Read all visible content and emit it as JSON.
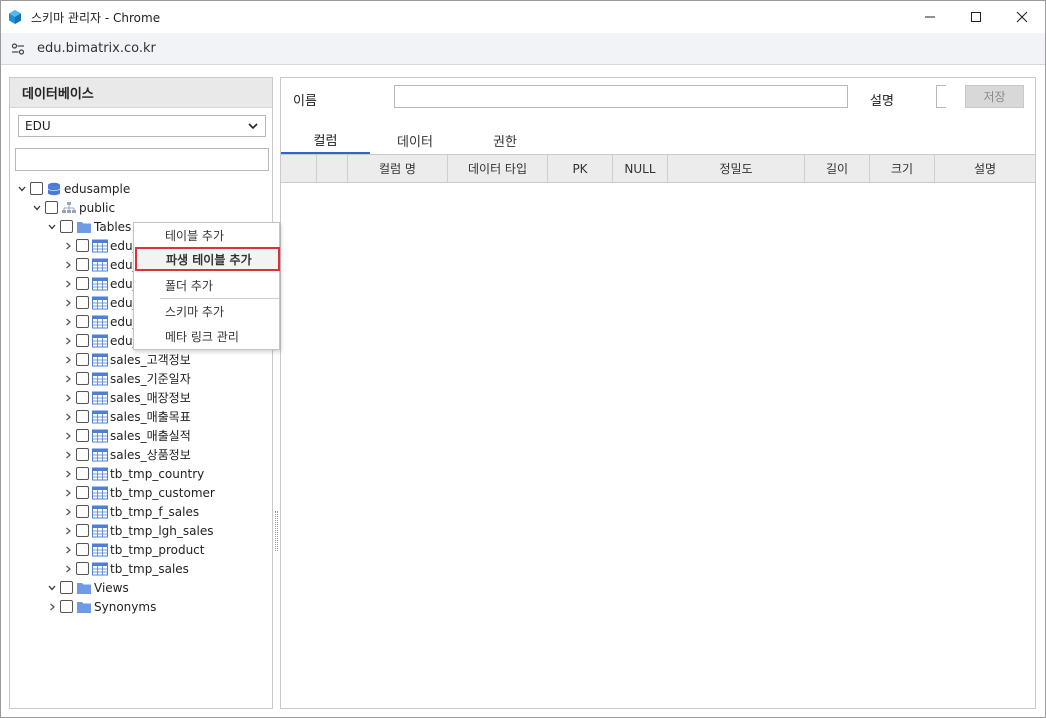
{
  "window": {
    "title": "스키마 관리자 - Chrome"
  },
  "browser": {
    "url": "edu.bimatrix.co.kr"
  },
  "left": {
    "header": "데이터베이스",
    "db_select": "EDU",
    "search_value": "",
    "tree": [
      {
        "label": "edusample",
        "icon": "database-icon",
        "expanded": true,
        "level": 0
      },
      {
        "label": "public",
        "icon": "schema-icon",
        "expanded": true,
        "level": 1
      },
      {
        "label": "Tables",
        "icon": "folder-icon",
        "expanded": true,
        "level": 2
      },
      {
        "label": "edu_",
        "icon": "table-icon",
        "level": 3
      },
      {
        "label": "edu_",
        "icon": "table-icon",
        "level": 3
      },
      {
        "label": "edu_",
        "icon": "table-icon",
        "level": 3
      },
      {
        "label": "edu_",
        "icon": "table-icon",
        "level": 3
      },
      {
        "label": "edu_",
        "icon": "table-icon",
        "level": 3
      },
      {
        "label": "edu_",
        "icon": "table-icon",
        "level": 3
      },
      {
        "label": "sales_고객정보",
        "icon": "table-icon",
        "level": 3
      },
      {
        "label": "sales_기준일자",
        "icon": "table-icon",
        "level": 3
      },
      {
        "label": "sales_매장정보",
        "icon": "table-icon",
        "level": 3
      },
      {
        "label": "sales_매출목표",
        "icon": "table-icon",
        "level": 3
      },
      {
        "label": "sales_매출실적",
        "icon": "table-icon",
        "level": 3
      },
      {
        "label": "sales_상품정보",
        "icon": "table-icon",
        "level": 3
      },
      {
        "label": "tb_tmp_country",
        "icon": "table-icon",
        "level": 3
      },
      {
        "label": "tb_tmp_customer",
        "icon": "table-icon",
        "level": 3
      },
      {
        "label": "tb_tmp_f_sales",
        "icon": "table-icon",
        "level": 3
      },
      {
        "label": "tb_tmp_lgh_sales",
        "icon": "table-icon",
        "level": 3
      },
      {
        "label": "tb_tmp_product",
        "icon": "table-icon",
        "level": 3
      },
      {
        "label": "tb_tmp_sales",
        "icon": "table-icon",
        "level": 3
      },
      {
        "label": "Views",
        "icon": "folder-icon",
        "expanded": true,
        "level": 2
      },
      {
        "label": "Synonyms",
        "icon": "folder-icon",
        "expanded": false,
        "level": 2
      }
    ]
  },
  "right": {
    "name_label": "이름",
    "name_value": "",
    "desc_label": "설명",
    "save_label": "저장",
    "tabs": [
      "컬럼",
      "데이터",
      "권한"
    ],
    "active_tab": "컬럼",
    "columns": [
      "",
      "",
      "컬럼 명",
      "데이터 타입",
      "PK",
      "NULL",
      "정밀도",
      "길이",
      "크기",
      "설명"
    ]
  },
  "context_menu": {
    "items": [
      "테이블 추가",
      "파생 테이블 추가",
      "폴더 추가",
      "스키마 추가",
      "메타 링크 관리"
    ],
    "highlighted": "파생 테이블 추가"
  },
  "colors": {
    "accent": "#2e67c9",
    "highlight_border": "#d9323a",
    "folder": "#6f9be6",
    "db": "#4a7bd8"
  }
}
